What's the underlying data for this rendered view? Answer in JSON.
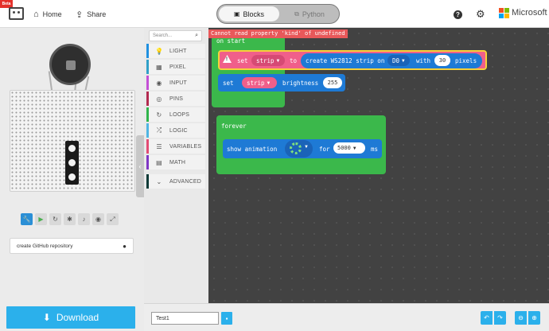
{
  "header": {
    "beta": "Beta",
    "home_label": "Home",
    "share_label": "Share",
    "blocks_label": "Blocks",
    "python_label": "Python",
    "brand": "Microsoft"
  },
  "simulator": {
    "github_label": "create GitHub repository",
    "download_label": "Download"
  },
  "toolbox": {
    "search_placeholder": "Search...",
    "categories": [
      {
        "label": "LIGHT",
        "icon": "lightbulb-icon",
        "color": "#1f90e0"
      },
      {
        "label": "PIXEL",
        "icon": "pixel-icon",
        "color": "#30a0c8"
      },
      {
        "label": "INPUT",
        "icon": "circle-icon",
        "color": "#c44fd6"
      },
      {
        "label": "PINS",
        "icon": "pins-icon",
        "color": "#b22a4f"
      },
      {
        "label": "LOOPS",
        "icon": "loop-icon",
        "color": "#30b44b"
      },
      {
        "label": "LOGIC",
        "icon": "shuffle-icon",
        "color": "#4fb5e3"
      },
      {
        "label": "VARIABLES",
        "icon": "list-icon",
        "color": "#e24b73"
      },
      {
        "label": "MATH",
        "icon": "calculator-icon",
        "color": "#7f36c4"
      },
      {
        "label": "ADVANCED",
        "icon": "chevron-down-icon",
        "color": "#0b3a36"
      }
    ]
  },
  "workspace": {
    "error": "Cannot read property 'kind' of undefined",
    "on_start_label": "on start",
    "set_label": "set",
    "strip_var": "strip",
    "to_label": "to",
    "create_label": "create WS2812 strip on",
    "pin": "D0",
    "with_label": "with",
    "pixel_count": "30",
    "pixels_label": "pixels",
    "brightness_label": "brightness",
    "brightness_value": "255",
    "forever_label": "forever",
    "show_animation_label": "show animation",
    "for_label": "for",
    "duration": "5000",
    "ms_label": "ms"
  },
  "bottom": {
    "project_name": "Test1"
  },
  "colors": {
    "accent": "#2bb0eb",
    "loops": "#3bb84b",
    "pixel": "#1e7ad5",
    "variable": "#f05f8a",
    "error": "#e8585a"
  }
}
